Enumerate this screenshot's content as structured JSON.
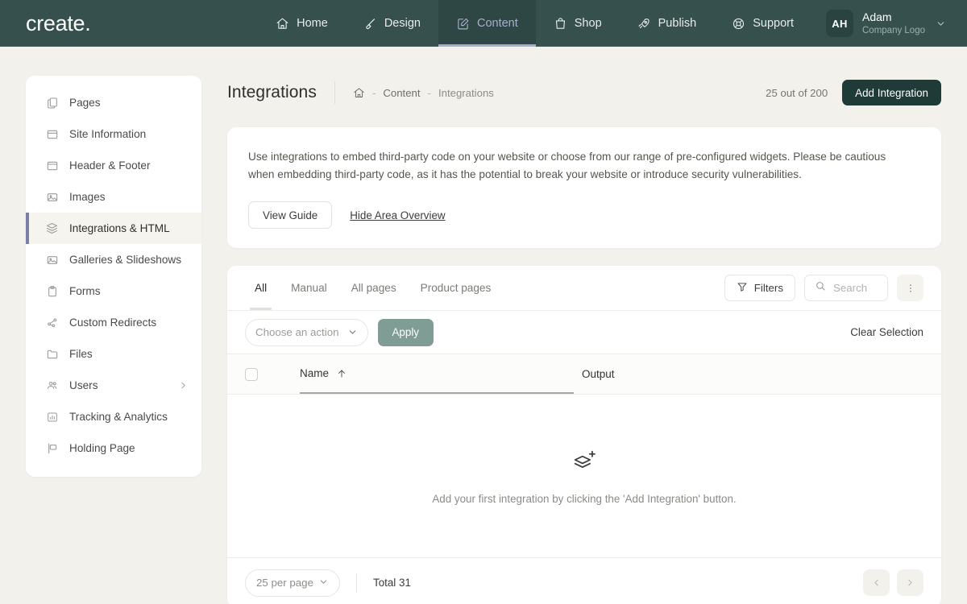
{
  "topnav": {
    "logo": "create.",
    "items": [
      {
        "label": "Home",
        "icon": "home-icon",
        "active": false
      },
      {
        "label": "Design",
        "icon": "brush-icon",
        "active": false
      },
      {
        "label": "Content",
        "icon": "edit-square-icon",
        "active": true
      },
      {
        "label": "Shop",
        "icon": "bag-icon",
        "active": false
      },
      {
        "label": "Publish",
        "icon": "rocket-icon",
        "active": false
      },
      {
        "label": "Support",
        "icon": "lifebuoy-icon",
        "active": false
      }
    ],
    "user": {
      "initials": "AH",
      "name": "Adam",
      "subtitle": "Company Logo"
    }
  },
  "sidebar": {
    "items": [
      {
        "label": "Pages",
        "icon": "copy-icon",
        "active": false,
        "submenu": false
      },
      {
        "label": "Site Information",
        "icon": "window-icon",
        "active": false,
        "submenu": false
      },
      {
        "label": "Header & Footer",
        "icon": "layout-icon",
        "active": false,
        "submenu": false
      },
      {
        "label": "Images",
        "icon": "image-icon",
        "active": false,
        "submenu": false
      },
      {
        "label": "Integrations & HTML",
        "icon": "layers-icon",
        "active": true,
        "submenu": false
      },
      {
        "label": "Galleries & Slideshows",
        "icon": "gallery-icon",
        "active": false,
        "submenu": false
      },
      {
        "label": "Forms",
        "icon": "clipboard-icon",
        "active": false,
        "submenu": false
      },
      {
        "label": "Custom Redirects",
        "icon": "share-icon",
        "active": false,
        "submenu": false
      },
      {
        "label": "Files",
        "icon": "folder-icon",
        "active": false,
        "submenu": false
      },
      {
        "label": "Users",
        "icon": "users-icon",
        "active": false,
        "submenu": true
      },
      {
        "label": "Tracking & Analytics",
        "icon": "bar-chart-icon",
        "active": false,
        "submenu": false
      },
      {
        "label": "Holding Page",
        "icon": "holding-page-icon",
        "active": false,
        "submenu": false
      }
    ]
  },
  "header": {
    "title": "Integrations",
    "breadcrumb": {
      "home_icon": "home-icon",
      "items": [
        "Content",
        "Integrations"
      ],
      "separator": "-"
    },
    "quota": "25 out of 200",
    "add_button": "Add Integration"
  },
  "info_panel": {
    "text": "Use integrations to embed third-party code on your website or choose from our range of pre-configured widgets. Please be cautious when embedding third-party code, as it has the potential to break your website or introduce security vulnerabilities.",
    "view_guide": "View Guide",
    "hide_overview": "Hide Area Overview"
  },
  "toolbar": {
    "tabs": [
      {
        "label": "All",
        "active": true
      },
      {
        "label": "Manual",
        "active": false
      },
      {
        "label": "All pages",
        "active": false
      },
      {
        "label": "Product pages",
        "active": false
      }
    ],
    "filters_label": "Filters",
    "search_placeholder": "Search",
    "search_value": "",
    "kebab": "more-options"
  },
  "actions": {
    "select_placeholder": "Choose an action",
    "apply_label": "Apply",
    "clear_label": "Clear Selection"
  },
  "table": {
    "columns": [
      "Name",
      "Output"
    ],
    "sort_column": "Name",
    "sort_direction": "ascending",
    "rows": [],
    "empty_message": "Add your first integration by clicking the 'Add Integration' button.",
    "empty_icon": "layers-plus-icon"
  },
  "footer": {
    "per_page": "25 per page",
    "total": "Total 31",
    "prev": "previous-page",
    "next": "next-page"
  },
  "colors": {
    "nav_bg": "#35504d",
    "nav_active_bg": "#2e4644",
    "nav_accent": "#a6abd0",
    "page_bg": "#f2f1ec",
    "primary_btn": "#1f3b38",
    "apply_btn": "#7f9c95",
    "sidebar_active_border": "#7b7fa8"
  }
}
